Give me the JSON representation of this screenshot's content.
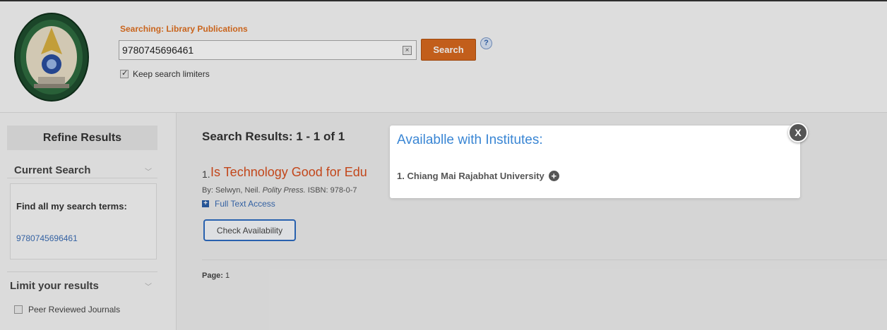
{
  "header": {
    "search_label": "Searching: Library Publications",
    "search_value": "9780745696461",
    "search_button": "Search",
    "help": "?",
    "keep_limiters": "Keep search limiters"
  },
  "sidebar": {
    "refine_title": "Refine Results",
    "current_search": "Current Search",
    "find_all_label": "Find all my search terms:",
    "term": "9780745696461",
    "limit_title": "Limit your results",
    "peer_reviewed": "Peer Reviewed Journals"
  },
  "results": {
    "title": "Search Results: 1 - 1 of 1",
    "items": [
      {
        "num": "1.",
        "title": "Is Technology Good for Edu",
        "meta_by": "By: Selwyn, Neil.",
        "meta_publisher": "Polity Press.",
        "meta_isbn": "ISBN: 978-0-7",
        "full_text": "Full Text Access",
        "check_availability": "Check Availability"
      }
    ],
    "page_label": "Page:",
    "page_value": "1"
  },
  "modal": {
    "title": "Availablle with Institutes:",
    "institutes": [
      "1. Chiang Mai Rajabhat University"
    ],
    "close": "X"
  },
  "colors": {
    "accent_orange": "#d9691f",
    "link_blue": "#3a6db5",
    "modal_title_blue": "#3a86d4",
    "result_title": "#d94e1e"
  }
}
